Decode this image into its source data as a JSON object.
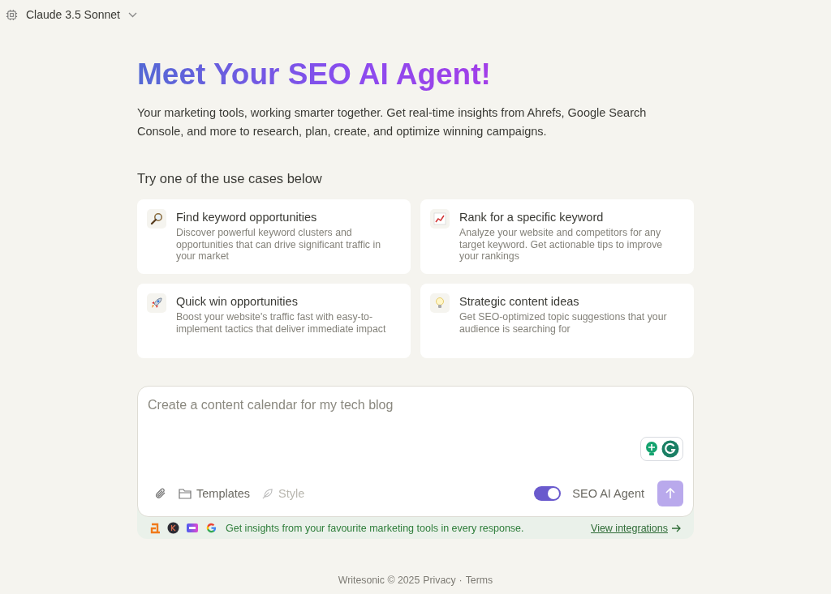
{
  "model_picker": {
    "label": "Claude 3.5 Sonnet"
  },
  "heading": "Meet Your SEO AI Agent!",
  "intro": "Your marketing tools, working smarter together. Get real-time insights from Ahrefs, Google Search Console, and more to research, plan, create, and optimize winning campaigns.",
  "use_cases_title": "Try one of the use cases below",
  "use_cases": [
    {
      "title": "Find keyword opportunities",
      "description": "Discover powerful keyword clusters and opportunities that can drive significant traffic in your market"
    },
    {
      "title": "Rank for a specific keyword",
      "description": "Analyze your website and competitors for any target keyword. Get actionable tips to improve your rankings"
    },
    {
      "title": "Quick win opportunities",
      "description": "Boost your website's traffic fast with easy-to-implement tactics that deliver immediate impact"
    },
    {
      "title": "Strategic content ideas",
      "description": "Get SEO-optimized topic suggestions that your audience is searching for"
    }
  ],
  "composer": {
    "placeholder": "Create a content calendar for my tech blog",
    "tools": [
      {
        "label": "Templates",
        "disabled": false
      },
      {
        "label": "Style",
        "disabled": true
      }
    ],
    "agent_toggle": {
      "label": "SEO AI Agent",
      "on": true
    },
    "send": {
      "disabled": true
    }
  },
  "integrations_bar": {
    "text": "Get insights from your favourite marketing tools in every response.",
    "link": "View integrations"
  },
  "footer": {
    "brand": "Writesonic © 2025",
    "links": [
      "Privacy",
      "Terms"
    ],
    "separator": "·"
  }
}
